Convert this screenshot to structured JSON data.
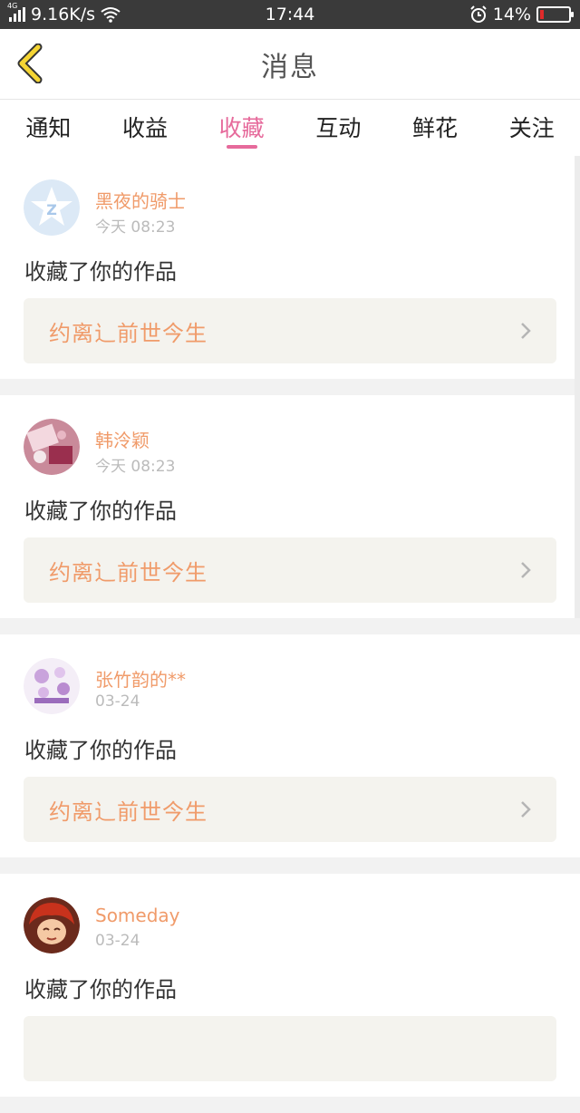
{
  "status_bar": {
    "network_tag": "4G",
    "speed": "9.16K/s",
    "time": "17:44",
    "battery": "14%",
    "battery_level": 0.14
  },
  "header": {
    "title": "消息"
  },
  "tabs": [
    {
      "label": "通知"
    },
    {
      "label": "收益"
    },
    {
      "label": "收藏"
    },
    {
      "label": "互动"
    },
    {
      "label": "鲜花"
    },
    {
      "label": "关注"
    }
  ],
  "active_tab": "收藏",
  "messages": [
    {
      "user": "黑夜的骑士",
      "time": "今天 08:23",
      "action": "收藏了你的作品",
      "work": "约离辶前世今生"
    },
    {
      "user": "韩泠颖",
      "time": "今天 08:23",
      "action": "收藏了你的作品",
      "work": "约离辶前世今生"
    },
    {
      "user": "张竹韵的**",
      "time": "03-24",
      "action": "收藏了你的作品",
      "work": "约离辶前世今生"
    },
    {
      "user": "Someday",
      "time": "03-24",
      "action": "收藏了你的作品",
      "work": ""
    }
  ],
  "colors": {
    "accent": "#e66a9b",
    "name": "#f09b6a",
    "back_arrow": "#f5d533"
  }
}
